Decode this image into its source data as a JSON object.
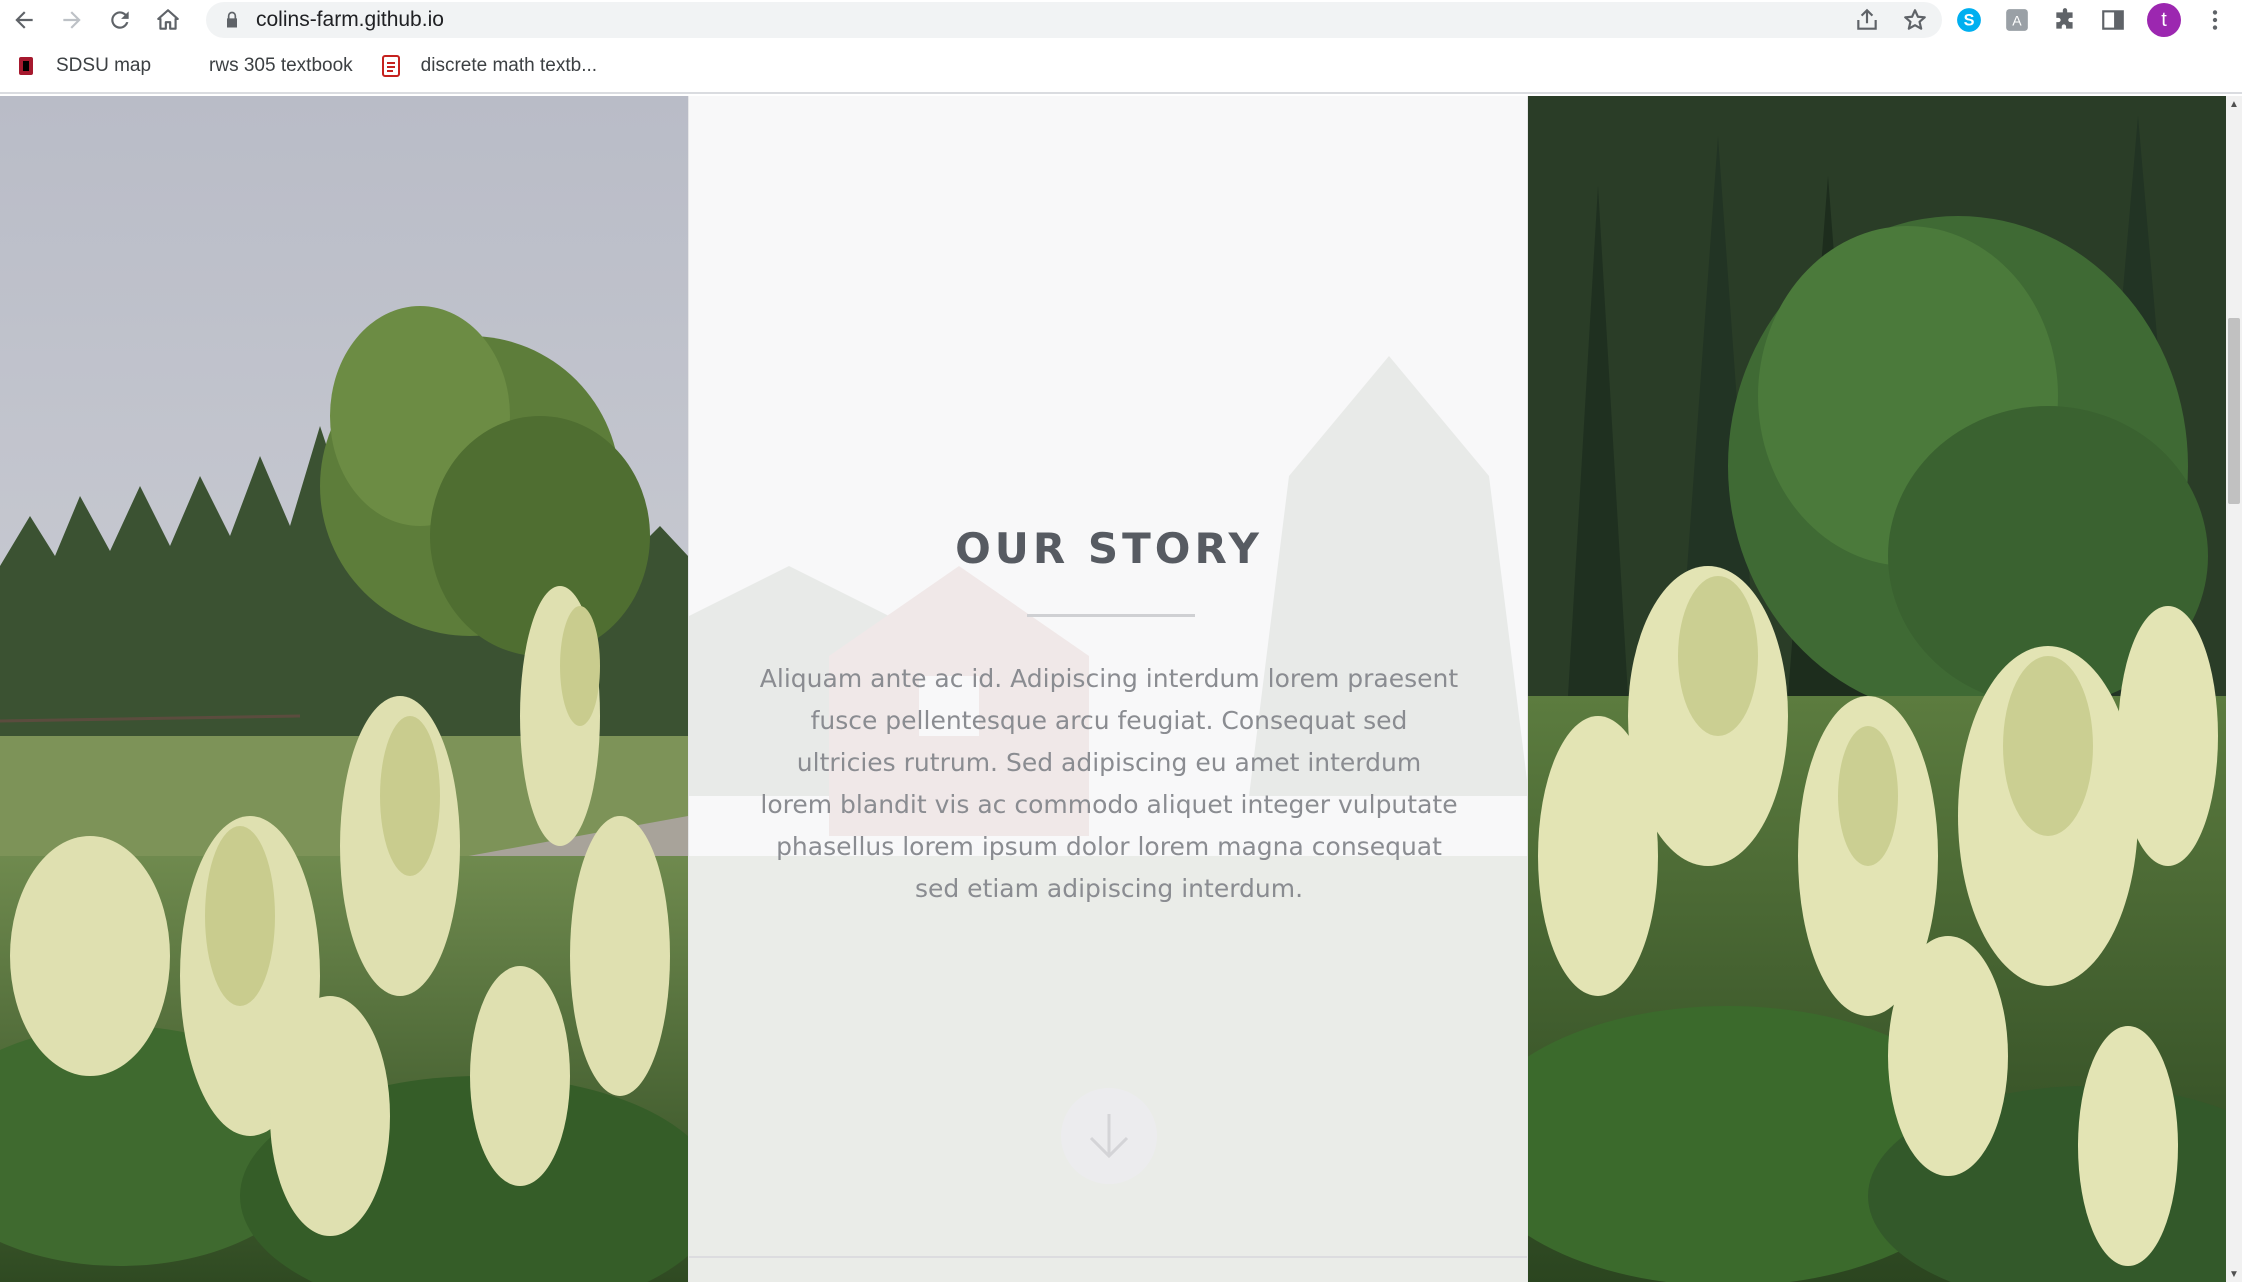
{
  "browser": {
    "url": "colins-farm.github.io",
    "avatar_letter": "t",
    "bookmarks": [
      {
        "label": "SDSU map"
      },
      {
        "label": "rws 305 textbook"
      },
      {
        "label": "discrete math textb..."
      }
    ],
    "colors": {
      "accent_avatar": "#9c27b0",
      "skype": "#00aff0"
    }
  },
  "page": {
    "story": {
      "title": "OUR STORY",
      "body": "Aliquam ante ac id. Adipiscing interdum lorem praesent fusce pellentesque arcu feugiat. Consequat sed ultricies rutrum. Sed adipiscing eu amet interdum lorem blandit vis ac commodo aliquet integer vulputate phasellus lorem ipsum dolor lorem magna consequat sed etiam adipiscing interdum."
    },
    "icons": {
      "down": "arrow-down-circle-icon"
    }
  }
}
